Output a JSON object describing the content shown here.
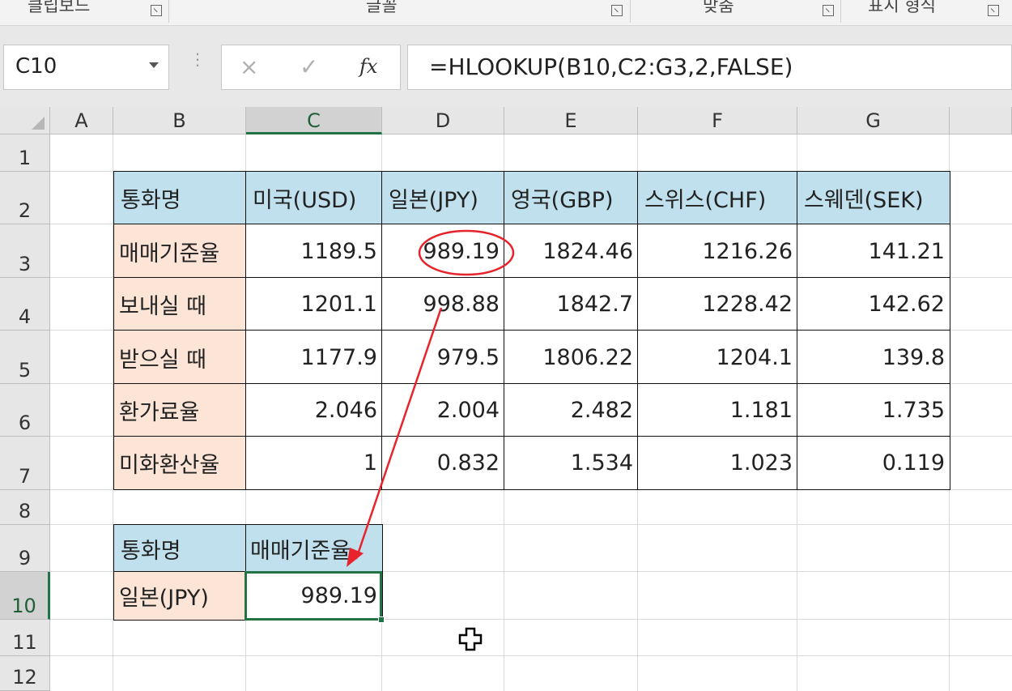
{
  "ribbon": {
    "groups": [
      {
        "label": "클립보드"
      },
      {
        "label": "글꼴"
      },
      {
        "label": "맞춤"
      },
      {
        "label": "표시 형식"
      }
    ]
  },
  "formula_bar": {
    "name_box": "C10",
    "cancel_icon": "×",
    "enter_icon": "✓",
    "fx_label": "fx",
    "formula": "=HLOOKUP(B10,C2:G3,2,FALSE)"
  },
  "columns": [
    "A",
    "B",
    "C",
    "D",
    "E",
    "F",
    "G"
  ],
  "rows": [
    "1",
    "2",
    "3",
    "4",
    "5",
    "6",
    "7",
    "8",
    "9",
    "10",
    "11",
    "12"
  ],
  "selected": {
    "column": "C",
    "row": "10"
  },
  "table": {
    "header": [
      "통화명",
      "미국(USD)",
      "일본(JPY)",
      "영국(GBP)",
      "스위스(CHF)",
      "스웨덴(SEK)"
    ],
    "rows": [
      {
        "label": "매매기준율",
        "values": [
          "1189.5",
          "989.19",
          "1824.46",
          "1216.26",
          "141.21"
        ]
      },
      {
        "label": "보내실 때",
        "values": [
          "1201.1",
          "998.88",
          "1842.7",
          "1228.42",
          "142.62"
        ]
      },
      {
        "label": "받으실 때",
        "values": [
          "1177.9",
          "979.5",
          "1806.22",
          "1204.1",
          "139.8"
        ]
      },
      {
        "label": "환가료율",
        "values": [
          "2.046",
          "2.004",
          "2.482",
          "1.181",
          "1.735"
        ]
      },
      {
        "label": "미화환산율",
        "values": [
          "1",
          "0.832",
          "1.534",
          "1.023",
          "0.119"
        ]
      }
    ]
  },
  "lookup": {
    "header": [
      "통화명",
      "매매기준율"
    ],
    "key": "일본(JPY)",
    "result": "989.19"
  },
  "colors": {
    "header_fill": "#bfe0ec",
    "label_fill": "#fce4d6",
    "selection": "#217346",
    "annotation": "#e8232b"
  }
}
